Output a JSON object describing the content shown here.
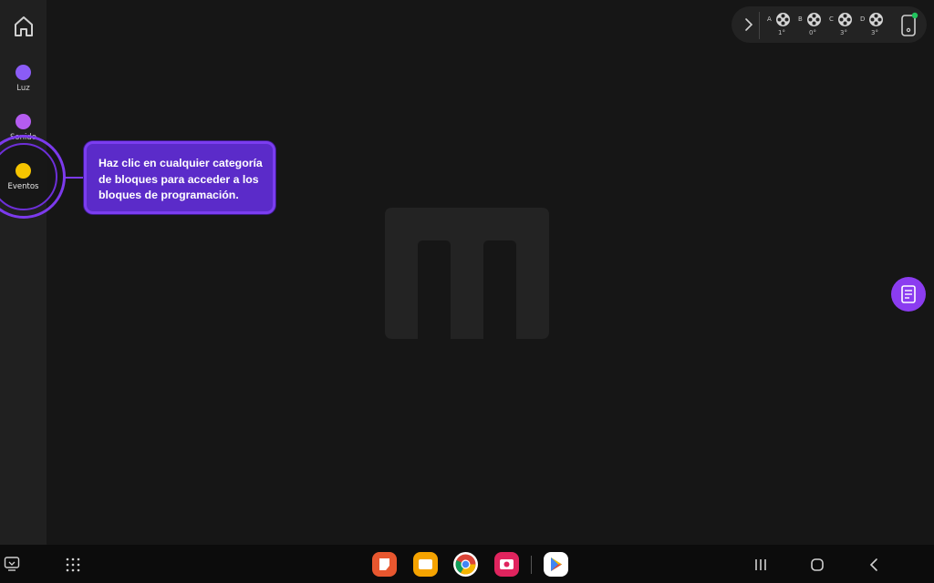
{
  "sidebar": {
    "home_icon": "home-icon",
    "categories": [
      {
        "label": "Luz",
        "color": "#8b5cf6"
      },
      {
        "label": "Sonido",
        "color": "#b45cf0"
      },
      {
        "label": "Eventos",
        "color": "#f5c400"
      }
    ]
  },
  "tooltip": {
    "text": "Haz clic en cualquier categoría de bloques para acceder a los bloques de programación."
  },
  "motors": [
    {
      "letter": "A",
      "degrees": "1°"
    },
    {
      "letter": "B",
      "degrees": "0°"
    },
    {
      "letter": "C",
      "degrees": "3°"
    },
    {
      "letter": "D",
      "degrees": "3°"
    }
  ],
  "icons": {
    "expand": "chevron-right-icon",
    "device": "phone-device-icon",
    "notes": "notes-icon",
    "logo": "m-logo-icon"
  },
  "colors": {
    "accent": "#7c3aed",
    "tooltip_bg": "#5b2bc9",
    "canvas_bg": "#161616",
    "sidebar_bg": "#202020",
    "connected": "#22c55e"
  },
  "taskbar": {
    "apps": [
      "notes-app-icon",
      "files-app-icon",
      "chrome-app-icon",
      "screen-recorder-icon",
      "play-store-icon"
    ],
    "nav": [
      "recents-icon",
      "home-nav-icon",
      "back-icon"
    ]
  }
}
